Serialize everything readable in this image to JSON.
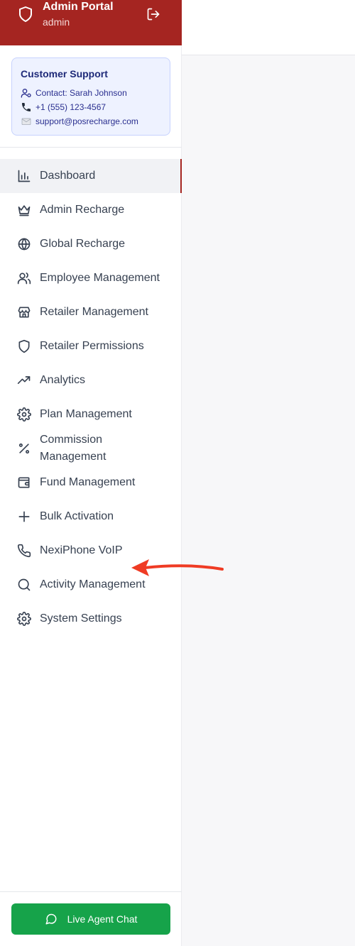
{
  "header": {
    "title": "Admin Portal",
    "subtitle": "admin"
  },
  "support": {
    "title": "Customer Support",
    "contact": "Contact: Sarah Johnson",
    "phone": "+1 (555) 123-4567",
    "email": "support@posrecharge.com"
  },
  "nav": {
    "items": [
      {
        "label": "Dashboard",
        "icon": "bar-chart-icon",
        "active": true
      },
      {
        "label": "Admin Recharge",
        "icon": "crown-icon"
      },
      {
        "label": "Global Recharge",
        "icon": "globe-icon"
      },
      {
        "label": "Employee Management",
        "icon": "users-icon"
      },
      {
        "label": "Retailer Management",
        "icon": "store-icon"
      },
      {
        "label": "Retailer Permissions",
        "icon": "shield-icon"
      },
      {
        "label": "Analytics",
        "icon": "trending-up-icon"
      },
      {
        "label": "Plan Management",
        "icon": "gear-icon"
      },
      {
        "label": "Commission Management",
        "icon": "percent-icon"
      },
      {
        "label": "Fund Management",
        "icon": "wallet-icon"
      },
      {
        "label": "Bulk Activation",
        "icon": "plus-icon"
      },
      {
        "label": "NexiPhone VoIP",
        "icon": "phone-icon"
      },
      {
        "label": "Activity Management",
        "icon": "search-icon"
      },
      {
        "label": "System Settings",
        "icon": "gear-icon"
      }
    ]
  },
  "chat_button": {
    "label": "Live Agent Chat",
    "icon": "message-circle-icon"
  },
  "colors": {
    "brand": "#a52521",
    "chat": "#16a34a",
    "annotation_arrow": "#ef3b24"
  }
}
